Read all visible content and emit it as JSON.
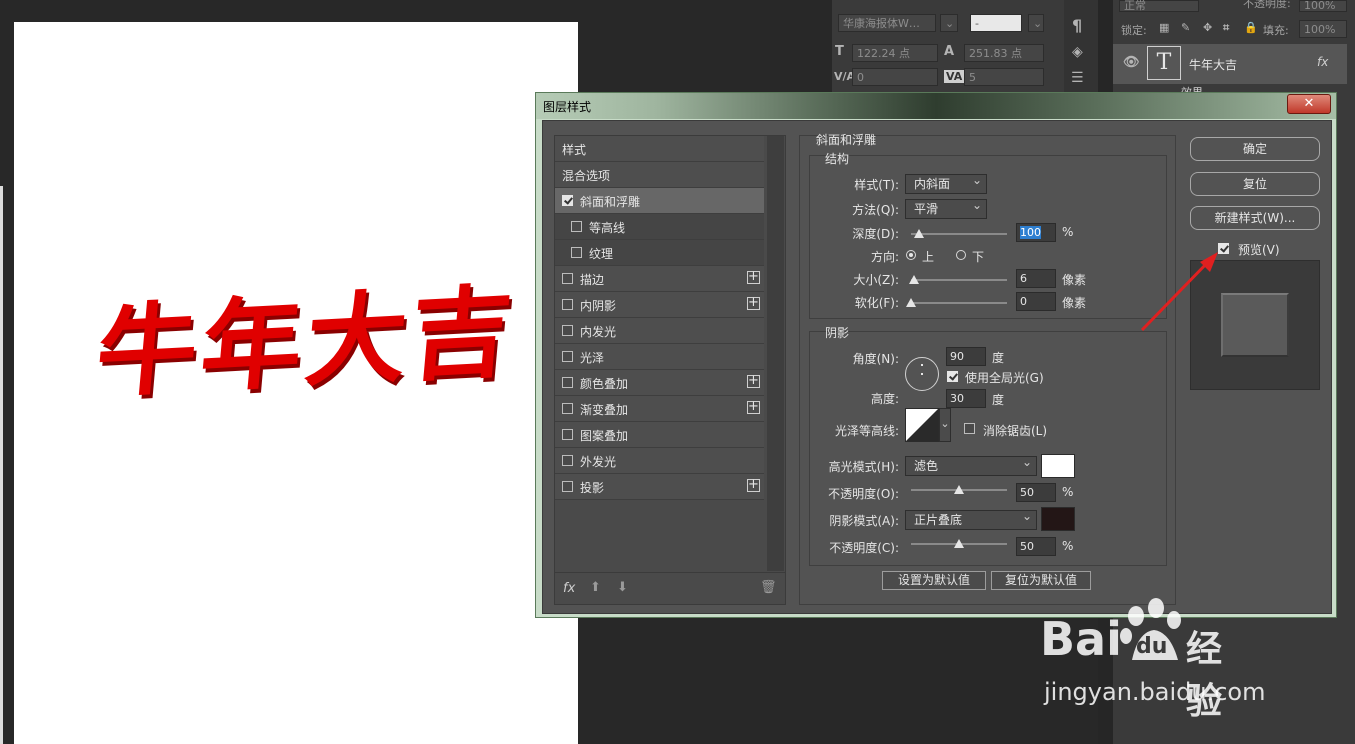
{
  "canvas": {
    "text": "牛年大吉",
    "text_color": "#e00000"
  },
  "character_panel": {
    "font_family": "华康海报体W…",
    "font_style": "-",
    "font_size": "122.24 点",
    "leading": "251.83 点",
    "kerning": "0",
    "tracking": "5",
    "kerning_label": "V/A",
    "tracking_label": "VA"
  },
  "layers_panel": {
    "blend_mode": "正常",
    "opacity_label": "不透明度:",
    "opacity": "100%",
    "lock_label": "锁定:",
    "fill_label": "填充:",
    "fill": "100%",
    "layer_name": "牛年大吉",
    "fx": "fx",
    "effects_label": "效果"
  },
  "dialog": {
    "title": "图层样式",
    "close": "✕",
    "styles_header": "样式",
    "blend_options": "混合选项",
    "styles": [
      {
        "label": "斜面和浮雕",
        "checked": true,
        "plus": false,
        "selected": true
      },
      {
        "label": "等高线",
        "checked": false,
        "plus": false,
        "sub": true
      },
      {
        "label": "纹理",
        "checked": false,
        "plus": false,
        "sub": true
      },
      {
        "label": "描边",
        "checked": false,
        "plus": true
      },
      {
        "label": "内阴影",
        "checked": false,
        "plus": true
      },
      {
        "label": "内发光",
        "checked": false,
        "plus": false
      },
      {
        "label": "光泽",
        "checked": false,
        "plus": false
      },
      {
        "label": "颜色叠加",
        "checked": false,
        "plus": true
      },
      {
        "label": "渐变叠加",
        "checked": false,
        "plus": true
      },
      {
        "label": "图案叠加",
        "checked": false,
        "plus": false
      },
      {
        "label": "外发光",
        "checked": false,
        "plus": false
      },
      {
        "label": "投影",
        "checked": false,
        "plus": true
      }
    ],
    "bottom_fx": "fx",
    "bevel": {
      "section_title": "斜面和浮雕",
      "structure_title": "结构",
      "style_label": "样式(T):",
      "style_value": "内斜面",
      "technique_label": "方法(Q):",
      "technique_value": "平滑",
      "depth_label": "深度(D):",
      "depth_value": "100",
      "depth_unit": "%",
      "depth_level": 0.08,
      "direction_label": "方向:",
      "direction_up": "上",
      "direction_down": "下",
      "size_label": "大小(Z):",
      "size_value": "6",
      "size_unit": "像素",
      "size_level": 0.03,
      "soften_label": "软化(F):",
      "soften_value": "0",
      "soften_unit": "像素",
      "soften_level": 0
    },
    "shading": {
      "title": "阴影",
      "angle_label": "角度(N):",
      "angle_value": "90",
      "angle_unit": "度",
      "global_light_label": "使用全局光(G)",
      "altitude_label": "高度:",
      "altitude_value": "30",
      "altitude_unit": "度",
      "gloss_contour_label": "光泽等高线:",
      "anti_alias_label": "消除锯齿(L)",
      "highlight_mode_label": "高光模式(H):",
      "highlight_mode_value": "滤色",
      "highlight_color": "#ffffff",
      "highlight_opacity_label": "不透明度(O):",
      "highlight_opacity": "50",
      "highlight_opacity_unit": "%",
      "shadow_mode_label": "阴影模式(A):",
      "shadow_mode_value": "正片叠底",
      "shadow_color": "#231616",
      "shadow_opacity_label": "不透明度(C):",
      "shadow_opacity": "50",
      "shadow_opacity_unit": "%"
    },
    "set_default": "设置为默认值",
    "reset_default": "复位为默认值",
    "ok": "确定",
    "reset": "复位",
    "new_style": "新建样式(W)...",
    "preview_label": "预览(V)"
  },
  "watermark": {
    "brand": "Bai",
    "brand2": "du",
    "service": "经验",
    "url": "jingyan.baidu.com"
  }
}
